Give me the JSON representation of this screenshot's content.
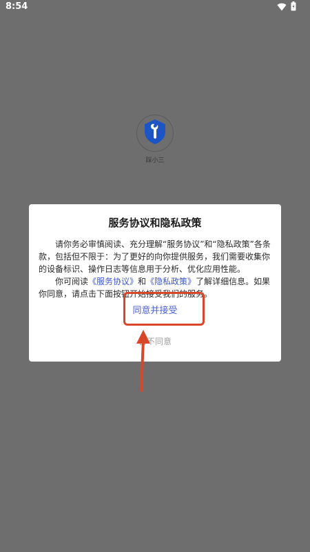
{
  "status_bar": {
    "time": "8:54",
    "icons": [
      "wifi-icon",
      "battery-icon"
    ]
  },
  "app": {
    "name": "踩小三",
    "logo": "wrench-shield-icon",
    "logo_color": "#1d55c6"
  },
  "dialog": {
    "title": "服务协议和隐私政策",
    "paragraph1": "请你务必审慎阅读、充分理解“服务协议”和“隐私政策”各条款，包括但不限于：为了更好的向你提供服务，我们需要收集你的设备标识、操作日志等信息用于分析、优化应用性能。",
    "paragraph2_before": "你可阅读",
    "link_service": "《服务协议》",
    "paragraph2_and": "和",
    "link_privacy": "《隐私政策》",
    "paragraph2_after": "了解详细信息。如果你同意，请点击下面按钮开始接受我们的服务。",
    "accept_label": "同意并接受",
    "decline_label": "暂不同意"
  },
  "colors": {
    "overlay": "#6e6e6e",
    "link": "#3c56c9",
    "accept": "#4b5fd4",
    "decline": "#a3a3a3",
    "annotation": "#d9472b"
  }
}
